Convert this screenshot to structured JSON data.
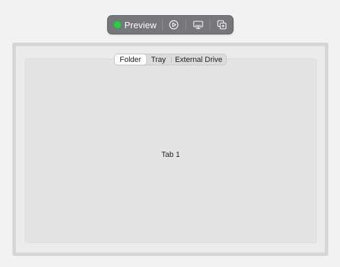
{
  "toolbar": {
    "status_color": "#35c84a",
    "preview_label": "Preview",
    "icons": [
      "play-icon",
      "device-icon",
      "duplicate-icon"
    ]
  },
  "tabs": {
    "items": [
      {
        "label": "Folder",
        "selected": true
      },
      {
        "label": "Tray",
        "selected": false
      },
      {
        "label": "External Drive",
        "selected": false
      }
    ]
  },
  "content": {
    "label": "Tab 1"
  }
}
